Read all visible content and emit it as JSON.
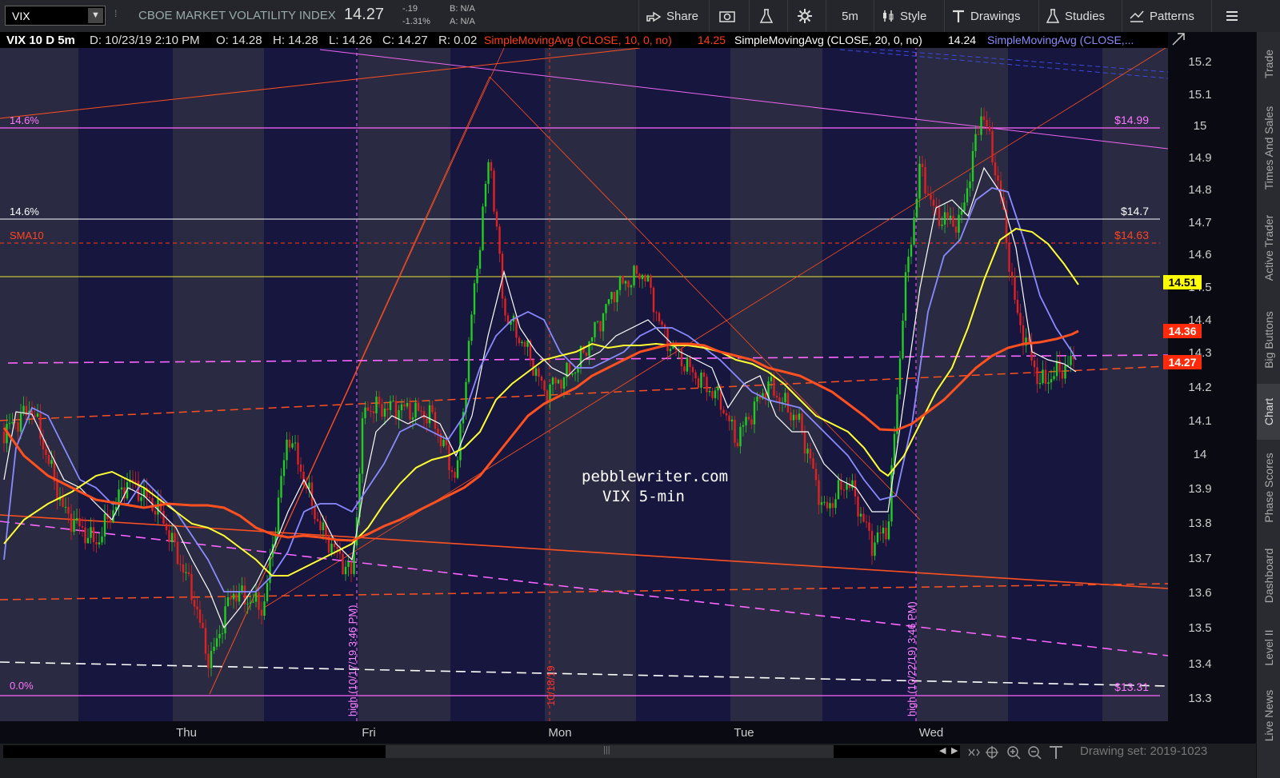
{
  "toolbar": {
    "symbol": "VIX",
    "description": "CBOE MARKET VOLATILITY INDEX",
    "last": "14.27",
    "change": "-.19",
    "change_pct": "-1.31%",
    "bid": "B: N/A",
    "ask": "A: N/A",
    "share": "Share",
    "timeframe": "5m",
    "style": "Style",
    "drawings": "Drawings",
    "studies": "Studies",
    "patterns": "Patterns"
  },
  "header": {
    "symbol_period": "VIX 10 D 5m",
    "date": "D: 10/23/19 2:10 PM",
    "open": "O: 14.28",
    "high": "H: 14.28",
    "low": "L: 14.26",
    "close": "C: 14.27",
    "range": "R: 0.02",
    "sma10_label": "SimpleMovingAvg (CLOSE, 10, 0, no)",
    "sma10_value": "14.25",
    "sma20_label": "SimpleMovingAvg (CLOSE, 20, 0, no)",
    "sma20_value": "14.24",
    "sma_more_label": "SimpleMovingAvg (CLOSE,..."
  },
  "chart": {
    "y_ticks": [
      "15.2",
      "15.1",
      "15",
      "14.9",
      "14.8",
      "14.7",
      "14.6",
      "14.5",
      "14.4",
      "14.3",
      "14.2",
      "14.1",
      "14",
      "13.9",
      "13.8",
      "13.7",
      "13.6",
      "13.5",
      "13.4",
      "13.3"
    ],
    "x_labels": [
      "Thu",
      "Fri",
      "Mon",
      "Tue",
      "Wed"
    ],
    "levels": {
      "fib_top_label": "14.6%",
      "fib_top_value": "$14.99",
      "line_147_label": "14.6%",
      "line_147_value": "$14.7",
      "sma10_label": "SMA10",
      "sma10_value": "$14.63",
      "fib_bottom_label": "0.0%",
      "fib_bottom_value": "$13.31"
    },
    "price_tags": {
      "yellow": "14.51",
      "orange": "14.36",
      "red": "14.27"
    },
    "vertical_annotations": {
      "high1": "high (10/17/19 3:46 PM)",
      "date1": "10/18/19",
      "high2": "high (10/22/19) 3:46 PM)"
    },
    "watermark_site": "pebblewriter.com",
    "watermark_sub": "VIX 5-min",
    "colors": {
      "background": "#0a0a12",
      "session_band": "#16163f",
      "off_band": "#2a2a42",
      "sma_fast": "#ff3b1a",
      "sma_white": "#ffffff",
      "sma_blue": "#8080ff",
      "sma_yellow": "#ffff33",
      "sma_orange": "#ff5020",
      "magenta": "#ff66ff",
      "candle_up": "#22cc22",
      "candle_down": "#dd2222"
    }
  },
  "sidebar": {
    "tabs": [
      "Trade",
      "Times And Sales",
      "Active Trader",
      "Big Buttons",
      "Chart",
      "Phase Scores",
      "Dashboard",
      "Level II",
      "Live News"
    ]
  },
  "footer": {
    "drawing_set": "Drawing set: 2019-1023"
  }
}
